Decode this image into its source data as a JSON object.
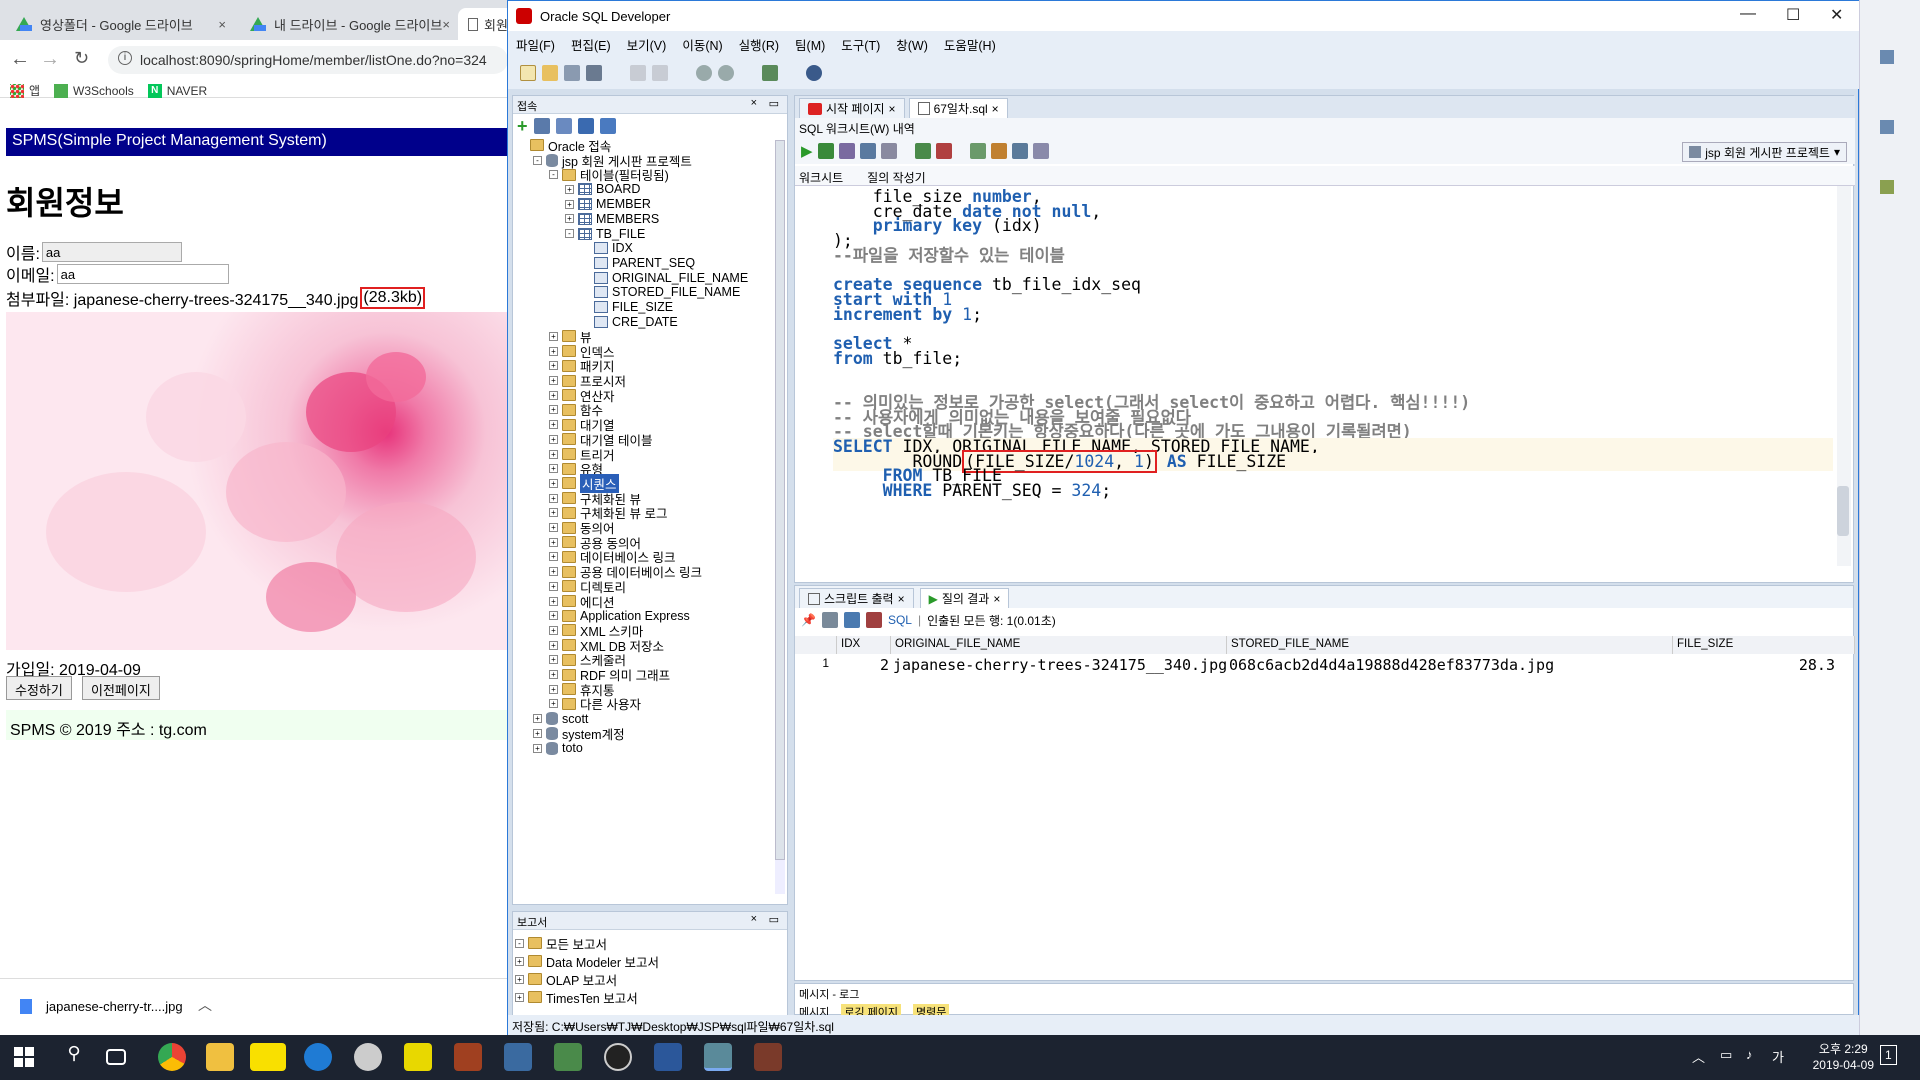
{
  "browser": {
    "tabs": [
      {
        "label": "영상폴더 - Google 드라이브",
        "close": "×"
      },
      {
        "label": "내 드라이브 - Google 드라이브",
        "close": "×"
      },
      {
        "label": "회원",
        "close": ""
      }
    ],
    "url": "localhost:8090/springHome/member/listOne.do?no=324",
    "bookmarks": [
      "앱",
      "W3Schools",
      "NAVER"
    ]
  },
  "page": {
    "header": "SPMS(Simple Project Management System)",
    "title": "회원정보",
    "name_label": "이름:",
    "name_value": "aa",
    "email_label": "이메일:",
    "email_value": "aa",
    "attach_label": "첨부파일: japanese-cherry-trees-324175__340.jpg",
    "attach_size": "(28.3kb)",
    "join_date": "가입일: 2019-04-09",
    "edit_button": "수정하기",
    "prev_button": "이전페이지",
    "footer": "SPMS © 2019 주소 : tg.com"
  },
  "download": {
    "filename": "japanese-cherry-tr....jpg"
  },
  "sqldev": {
    "title": "Oracle SQL Developer",
    "menu": [
      "파일(F)",
      "편집(E)",
      "보기(V)",
      "이동(N)",
      "실행(R)",
      "팀(M)",
      "도구(T)",
      "창(W)",
      "도움말(H)"
    ],
    "conn_panel_title": "접속",
    "tree": [
      {
        "label": "Oracle 접속",
        "indent": 0,
        "icon": "folder",
        "pm": ""
      },
      {
        "label": "jsp 회원 게시판 프로젝트",
        "indent": 1,
        "icon": "db",
        "pm": "-"
      },
      {
        "label": "테이블(필터링됨)",
        "indent": 2,
        "icon": "folder",
        "pm": "-"
      },
      {
        "label": "BOARD",
        "indent": 3,
        "icon": "table",
        "pm": "+"
      },
      {
        "label": "MEMBER",
        "indent": 3,
        "icon": "table",
        "pm": "+"
      },
      {
        "label": "MEMBERS",
        "indent": 3,
        "icon": "table",
        "pm": "+"
      },
      {
        "label": "TB_FILE",
        "indent": 3,
        "icon": "table",
        "pm": "-"
      },
      {
        "label": "IDX",
        "indent": 4,
        "icon": "col",
        "pm": ""
      },
      {
        "label": "PARENT_SEQ",
        "indent": 4,
        "icon": "col",
        "pm": ""
      },
      {
        "label": "ORIGINAL_FILE_NAME",
        "indent": 4,
        "icon": "col",
        "pm": ""
      },
      {
        "label": "STORED_FILE_NAME",
        "indent": 4,
        "icon": "col",
        "pm": ""
      },
      {
        "label": "FILE_SIZE",
        "indent": 4,
        "icon": "col",
        "pm": ""
      },
      {
        "label": "CRE_DATE",
        "indent": 4,
        "icon": "col",
        "pm": ""
      },
      {
        "label": "뷰",
        "indent": 2,
        "icon": "folder",
        "pm": "+"
      },
      {
        "label": "인덱스",
        "indent": 2,
        "icon": "folder",
        "pm": "+"
      },
      {
        "label": "패키지",
        "indent": 2,
        "icon": "folder",
        "pm": "+"
      },
      {
        "label": "프로시저",
        "indent": 2,
        "icon": "folder",
        "pm": "+"
      },
      {
        "label": "연산자",
        "indent": 2,
        "icon": "folder",
        "pm": "+"
      },
      {
        "label": "함수",
        "indent": 2,
        "icon": "folder",
        "pm": "+"
      },
      {
        "label": "대기열",
        "indent": 2,
        "icon": "folder",
        "pm": "+"
      },
      {
        "label": "대기열 테이블",
        "indent": 2,
        "icon": "folder",
        "pm": "+"
      },
      {
        "label": "트리거",
        "indent": 2,
        "icon": "folder",
        "pm": "+"
      },
      {
        "label": "유형",
        "indent": 2,
        "icon": "folder",
        "pm": "+"
      },
      {
        "label": "시퀀스",
        "indent": 2,
        "icon": "folder",
        "pm": "+",
        "selected": true
      },
      {
        "label": "구체화된 뷰",
        "indent": 2,
        "icon": "folder",
        "pm": "+"
      },
      {
        "label": "구체화된 뷰 로그",
        "indent": 2,
        "icon": "folder",
        "pm": "+"
      },
      {
        "label": "동의어",
        "indent": 2,
        "icon": "folder",
        "pm": "+"
      },
      {
        "label": "공용 동의어",
        "indent": 2,
        "icon": "folder",
        "pm": "+"
      },
      {
        "label": "데이터베이스 링크",
        "indent": 2,
        "icon": "folder",
        "pm": "+"
      },
      {
        "label": "공용 데이터베이스 링크",
        "indent": 2,
        "icon": "folder",
        "pm": "+"
      },
      {
        "label": "디렉토리",
        "indent": 2,
        "icon": "folder",
        "pm": "+"
      },
      {
        "label": "에디션",
        "indent": 2,
        "icon": "folder",
        "pm": "+"
      },
      {
        "label": "Application Express",
        "indent": 2,
        "icon": "folder",
        "pm": "+"
      },
      {
        "label": "XML 스키마",
        "indent": 2,
        "icon": "folder",
        "pm": "+"
      },
      {
        "label": "XML DB 저장소",
        "indent": 2,
        "icon": "folder",
        "pm": "+"
      },
      {
        "label": "스케줄러",
        "indent": 2,
        "icon": "folder",
        "pm": "+"
      },
      {
        "label": "RDF 의미 그래프",
        "indent": 2,
        "icon": "folder",
        "pm": "+"
      },
      {
        "label": "휴지통",
        "indent": 2,
        "icon": "folder",
        "pm": "+"
      },
      {
        "label": "다른 사용자",
        "indent": 2,
        "icon": "folder",
        "pm": "+"
      },
      {
        "label": "scott",
        "indent": 1,
        "icon": "db",
        "pm": "+"
      },
      {
        "label": "system계정",
        "indent": 1,
        "icon": "db",
        "pm": "+"
      },
      {
        "label": "toto",
        "indent": 1,
        "icon": "db",
        "pm": "+"
      }
    ],
    "report_panel_title": "보고서",
    "reports": [
      "모든 보고서",
      "Data Modeler 보고서",
      "OLAP 보고서",
      "TimesTen 보고서"
    ],
    "editor_tabs": [
      "시작 페이지",
      "67일차.sql"
    ],
    "worksheet_bar": "SQL 워크시트(W) 내역",
    "connection_select": "jsp 회원 게시판 프로젝트",
    "subtabs": [
      "워크시트",
      "질의 작성기"
    ],
    "code_lines": [
      [
        {
          "t": "    file_size ",
          "c": ""
        },
        {
          "t": "number",
          "c": "kw"
        },
        {
          "t": ",",
          "c": ""
        }
      ],
      [
        {
          "t": "    cre_date ",
          "c": ""
        },
        {
          "t": "date not null",
          "c": "kw"
        },
        {
          "t": ",",
          "c": ""
        }
      ],
      [
        {
          "t": "    ",
          "c": ""
        },
        {
          "t": "primary key",
          "c": "kw"
        },
        {
          "t": " (idx)",
          "c": ""
        }
      ],
      [
        {
          "t": ");",
          "c": ""
        }
      ],
      [
        {
          "t": "--파일을 저장할수 있는 테이블",
          "c": "cm"
        }
      ],
      [
        {
          "t": "",
          "c": ""
        }
      ],
      [
        {
          "t": "create sequence",
          "c": "kw"
        },
        {
          "t": " tb_file_idx_seq",
          "c": ""
        }
      ],
      [
        {
          "t": "start with ",
          "c": "kw"
        },
        {
          "t": "1",
          "c": "num"
        }
      ],
      [
        {
          "t": "increment by ",
          "c": "kw"
        },
        {
          "t": "1",
          "c": "num"
        },
        {
          "t": ";",
          "c": ""
        }
      ],
      [
        {
          "t": "",
          "c": ""
        }
      ],
      [
        {
          "t": "select",
          "c": "kw"
        },
        {
          "t": " *",
          "c": ""
        }
      ],
      [
        {
          "t": "from",
          "c": "kw"
        },
        {
          "t": " tb_file;",
          "c": ""
        }
      ],
      [
        {
          "t": "",
          "c": ""
        }
      ],
      [
        {
          "t": "",
          "c": ""
        }
      ],
      [
        {
          "t": "-- 의미있는 정보로 가공한 select(그래서 select이 중요하고 어렵다. 핵심!!!!)",
          "c": "cm"
        }
      ],
      [
        {
          "t": "-- 사용자에게 의미없는 내용을 보여줄 필요없다",
          "c": "cm"
        }
      ],
      [
        {
          "t": "-- select할때 기본키는 항상중요하다(다른 곳에 가도 그내용이 기록될려면)",
          "c": "cm"
        }
      ],
      [
        {
          "t": "SELECT",
          "c": "kw"
        },
        {
          "t": " IDX, ORIGINAL_FILE_NAME, STORED_FILE_NAME,",
          "c": ""
        }
      ],
      [
        {
          "t": "        ROUND",
          "c": ""
        },
        {
          "t": "(FILE_SIZE/",
          "c": "box"
        },
        {
          "t": "1024",
          "c": "boxnum"
        },
        {
          "t": ", ",
          "c": "box"
        },
        {
          "t": "1",
          "c": "boxnum"
        },
        {
          "t": ")",
          "c": "box"
        },
        {
          "t": " AS",
          "c": "kw"
        },
        {
          "t": " FILE_SIZE",
          "c": ""
        }
      ],
      [
        {
          "t": "     FROM",
          "c": "kw"
        },
        {
          "t": " TB_FILE",
          "c": ""
        }
      ],
      [
        {
          "t": "     WHERE",
          "c": "kw"
        },
        {
          "t": " PARENT_SEQ = ",
          "c": ""
        },
        {
          "t": "324",
          "c": "num"
        },
        {
          "t": ";",
          "c": ""
        }
      ]
    ],
    "result_tabs": [
      "스크립트 출력",
      "질의 결과"
    ],
    "result_status": "인출된 모든 행: 1(0.01초)",
    "result_sql_label": "SQL",
    "grid_headers": [
      "",
      "IDX",
      "ORIGINAL_FILE_NAME",
      "STORED_FILE_NAME",
      "FILE_SIZE"
    ],
    "grid_row": [
      "1",
      "2",
      "japanese-cherry-trees-324175__340.jpg",
      "068c6acb2d4d4a19888d428ef83773da.jpg",
      "28.3"
    ],
    "msglog_title": "메시지 - 로그",
    "msglog_tabs": [
      "메시지",
      "로깅 페이지",
      "명령문"
    ],
    "status": "저장됨: C:₩Users₩TJ₩Desktop₩JSP₩sql파일₩67일차.sql"
  },
  "taskbar": {
    "time": "오후 2:29",
    "date": "2019-04-09",
    "ime": "가",
    "notif": "1"
  }
}
